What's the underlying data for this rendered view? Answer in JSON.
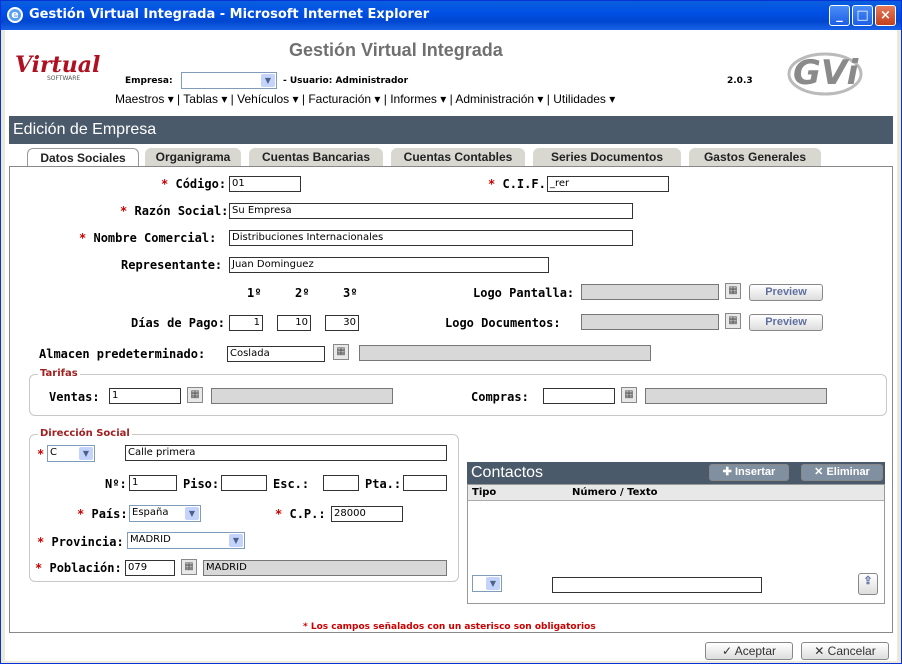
{
  "window": {
    "title": "Gestión Virtual Integrada - Microsoft Internet Explorer",
    "minimize": "_",
    "maximize": "□",
    "close": "×"
  },
  "header": {
    "app_title": "Gestión Virtual Integrada",
    "logo_text": "Virtual",
    "logo_sub": "SOFTWARE",
    "empresa_label": "Empresa:",
    "empresa_value": "",
    "user_label": "- Usuario: Administrador",
    "version": "2.0.3",
    "gvi_logo": "GVi"
  },
  "menu": {
    "items": [
      "Maestros",
      "Tablas",
      "Vehículos",
      "Facturación",
      "Informes",
      "Administración",
      "Utilidades"
    ]
  },
  "section_title": "Edición de Empresa",
  "tabs": [
    "Datos Sociales",
    "Organigrama",
    "Cuentas Bancarias",
    "Cuentas Contables",
    "Series Documentos",
    "Gastos Generales"
  ],
  "form": {
    "codigo_label": "Código:",
    "codigo": "01",
    "cif_label": "C.I.F.:",
    "cif": "_rer",
    "razon_label": "Razón Social:",
    "razon": "Su Empresa",
    "nombre_label": "Nombre Comercial:",
    "nombre": "Distribuciones Internacionales",
    "representante_label": "Representante:",
    "representante": "Juan Dominguez",
    "pago_h1": "1º",
    "pago_h2": "2º",
    "pago_h3": "3º",
    "dias_label": "Días de Pago:",
    "dia1": "1",
    "dia2": "10",
    "dia3": "30",
    "logo_pantalla_label": "Logo Pantalla:",
    "logo_docs_label": "Logo Documentos:",
    "preview": "Preview",
    "almacen_label": "Almacen predeterminado:",
    "almacen": "Coslada",
    "tarifas_legend": "Tarifas",
    "ventas_label": "Ventas:",
    "ventas": "1",
    "compras_label": "Compras:",
    "compras": "",
    "dir_legend": "Dirección Social",
    "tipo_via": "C",
    "calle": "Calle primera",
    "num_label": "Nº:",
    "num": "1",
    "piso_label": "Piso:",
    "esc_label": "Esc.:",
    "pta_label": "Pta.:",
    "pais_label": "País:",
    "pais": "España",
    "cp_label": "C.P.:",
    "cp": "28000",
    "provincia_label": "Provincia:",
    "provincia": "MADRID",
    "poblacion_label": "Población:",
    "poblacion_code": "079",
    "poblacion": "MADRID",
    "required_mark": "*"
  },
  "contactos": {
    "title": "Contactos",
    "insert": "Insertar",
    "delete": "Eliminar",
    "col_tipo": "Tipo",
    "col_numero": "Número / Texto"
  },
  "note": "* Los campos señalados con un asterisco son obligatorios",
  "footer": {
    "accept": "Aceptar",
    "cancel": "Cancelar"
  }
}
